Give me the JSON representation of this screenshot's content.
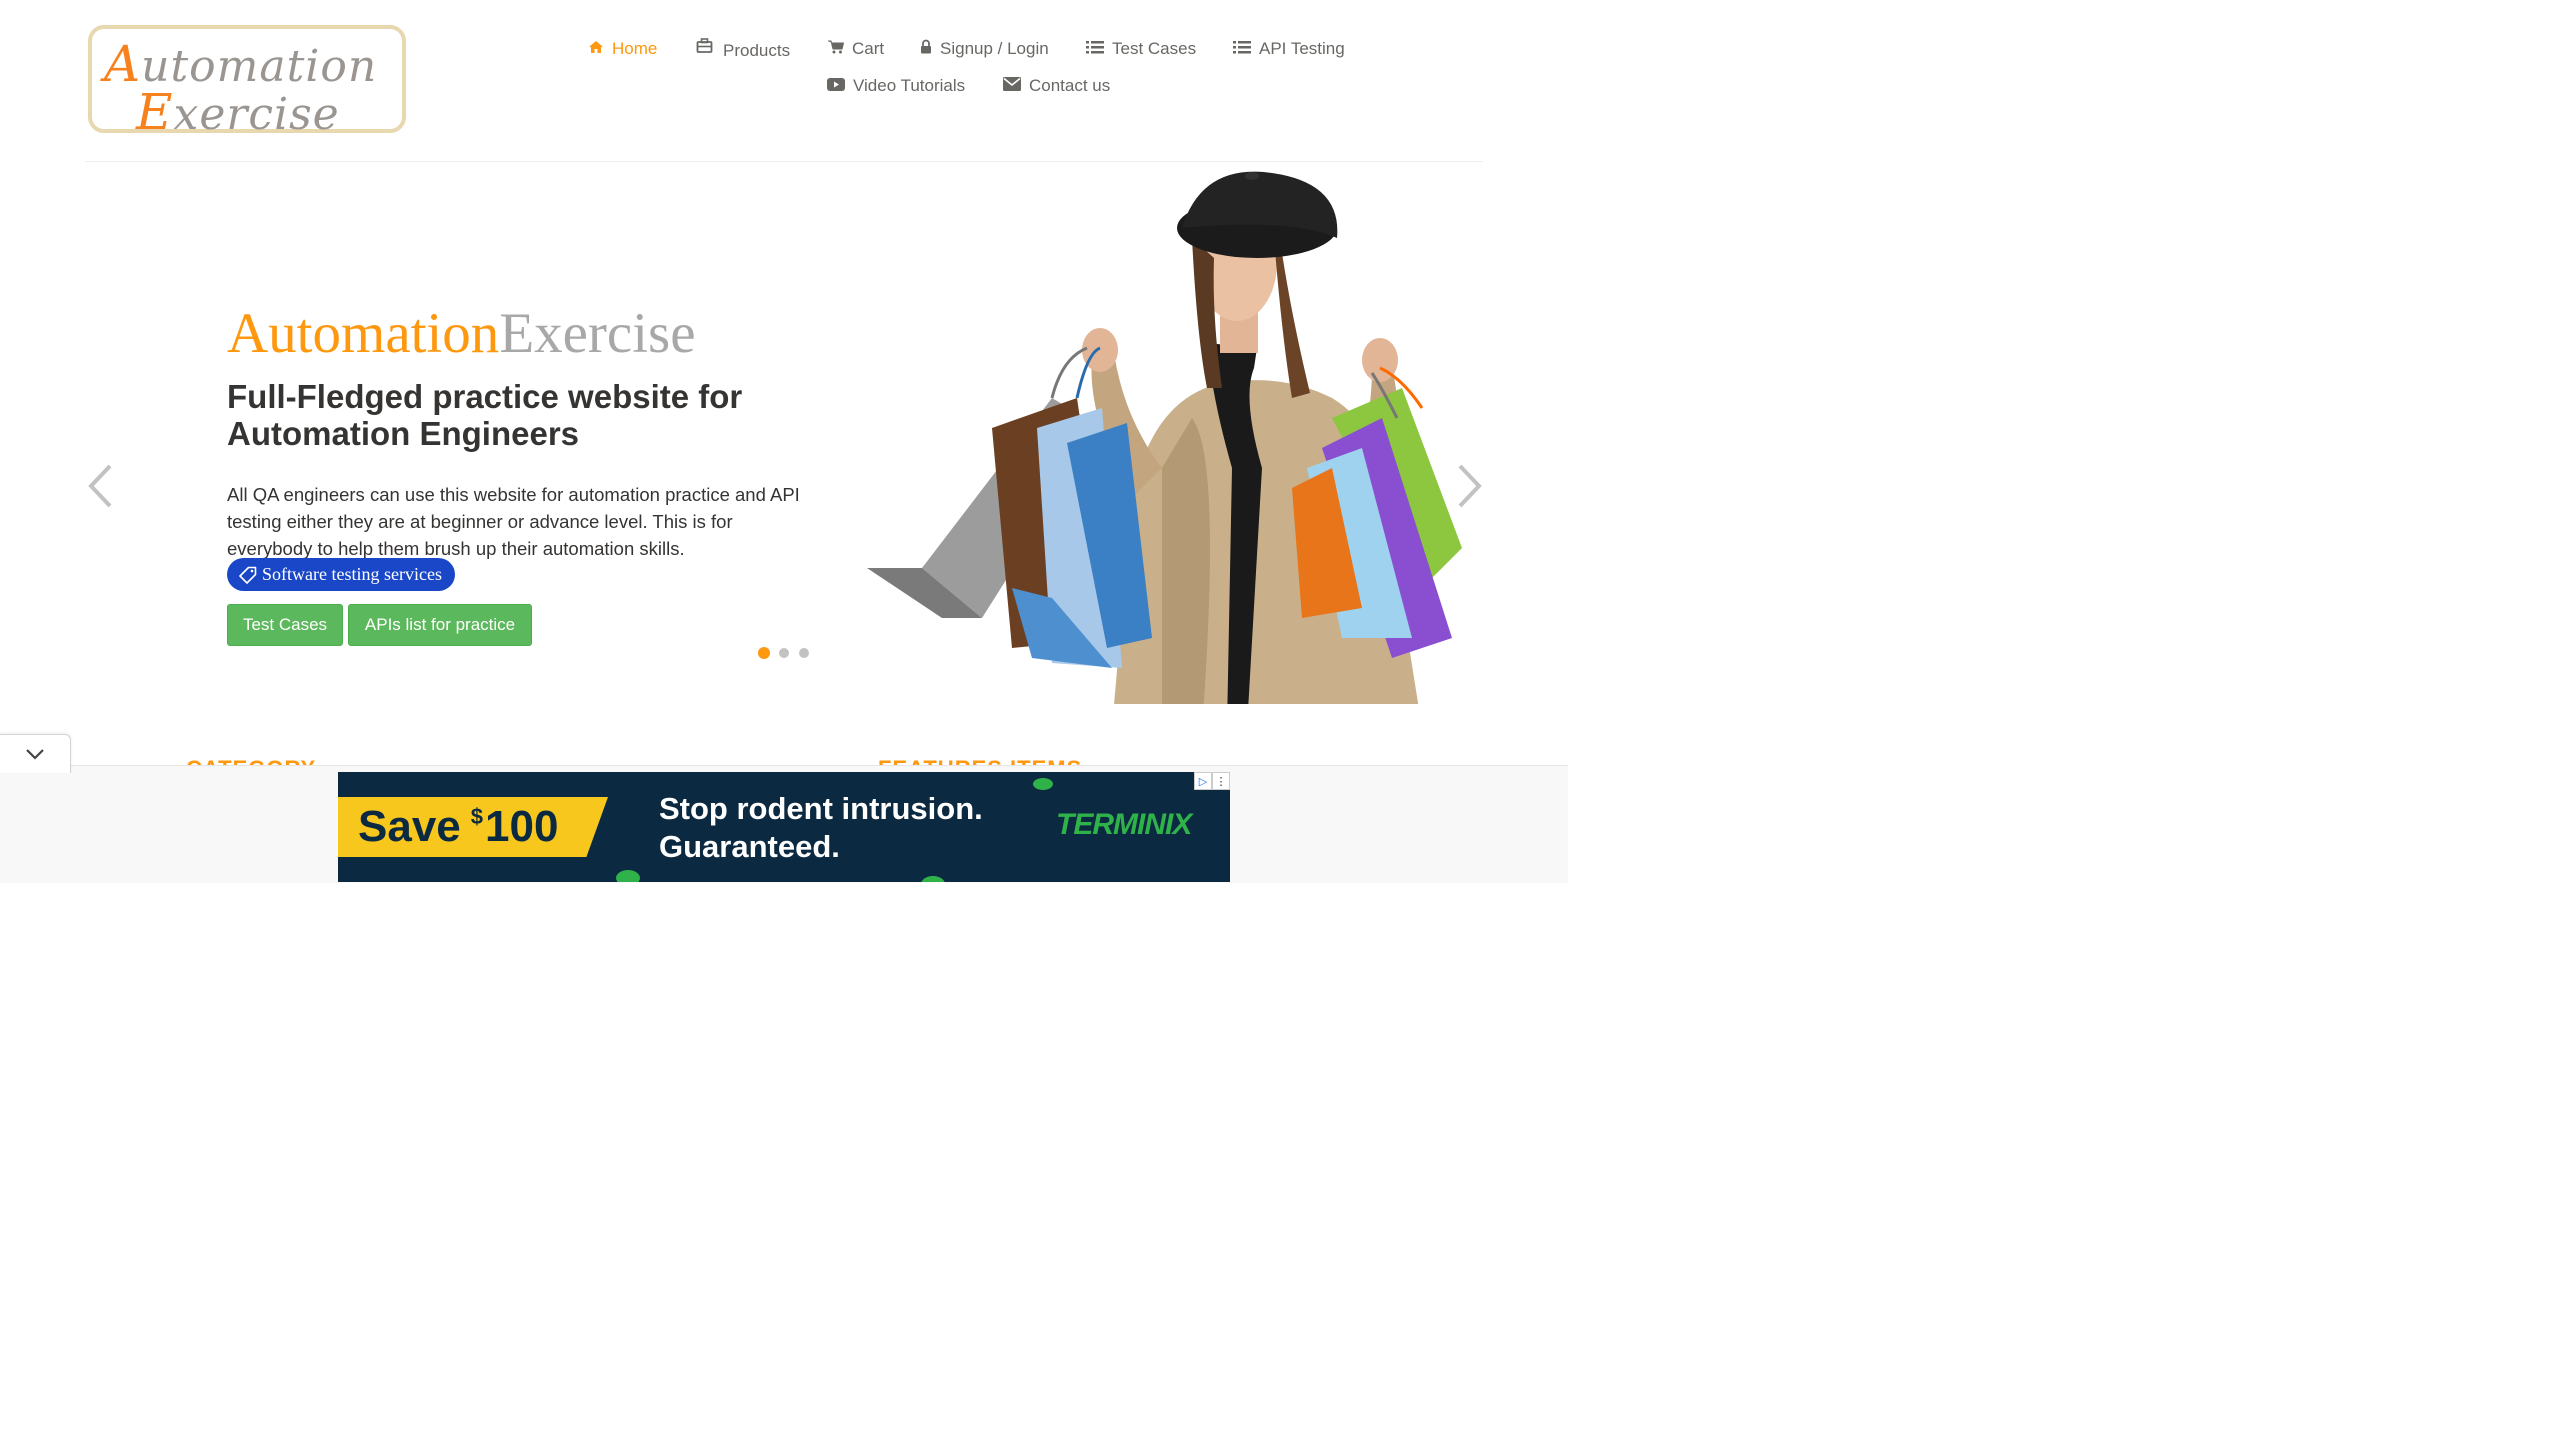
{
  "logo": {
    "line1_cap": "A",
    "line1_rest": "utomation",
    "line2_cap": "E",
    "line2_rest": "xercise"
  },
  "nav": [
    {
      "label": "Home",
      "icon": "home-icon",
      "active": true
    },
    {
      "label": "Products",
      "icon": "briefcase-icon"
    },
    {
      "label": "Cart",
      "icon": "cart-icon"
    },
    {
      "label": "Signup / Login",
      "icon": "lock-icon"
    },
    {
      "label": "Test Cases",
      "icon": "list-icon"
    },
    {
      "label": "API Testing",
      "icon": "list-icon"
    },
    {
      "label": "Video Tutorials",
      "icon": "youtube-icon"
    },
    {
      "label": "Contact us",
      "icon": "envelope-icon"
    }
  ],
  "slider": {
    "title_a": "Automation",
    "title_b": "Exercise",
    "heading": "Full-Fledged practice website for Automation Engineers",
    "description": "All QA engineers can use this website for automation practice and API testing either they are at beginner or advance level. This is for everybody to help them brush up their automation skills.",
    "tag_label": "Software testing services",
    "btn_test_cases": "Test Cases",
    "btn_apis": "APIs list for practice",
    "active_slide": 1,
    "slide_count": 3
  },
  "sections": {
    "category": "CATEGORY",
    "features": "FEATURES ITEMS"
  },
  "ad": {
    "save_word": "Save",
    "save_currency": "$",
    "save_amount": "100",
    "line1": "Stop rodent intrusion.",
    "line2": "Guaranteed.",
    "brand": "TERMINIX"
  },
  "colors": {
    "accent": "#fe980f",
    "green_button": "#5cb85c",
    "tag_blue": "#1a47c7",
    "ad_bg": "#0b2940"
  }
}
